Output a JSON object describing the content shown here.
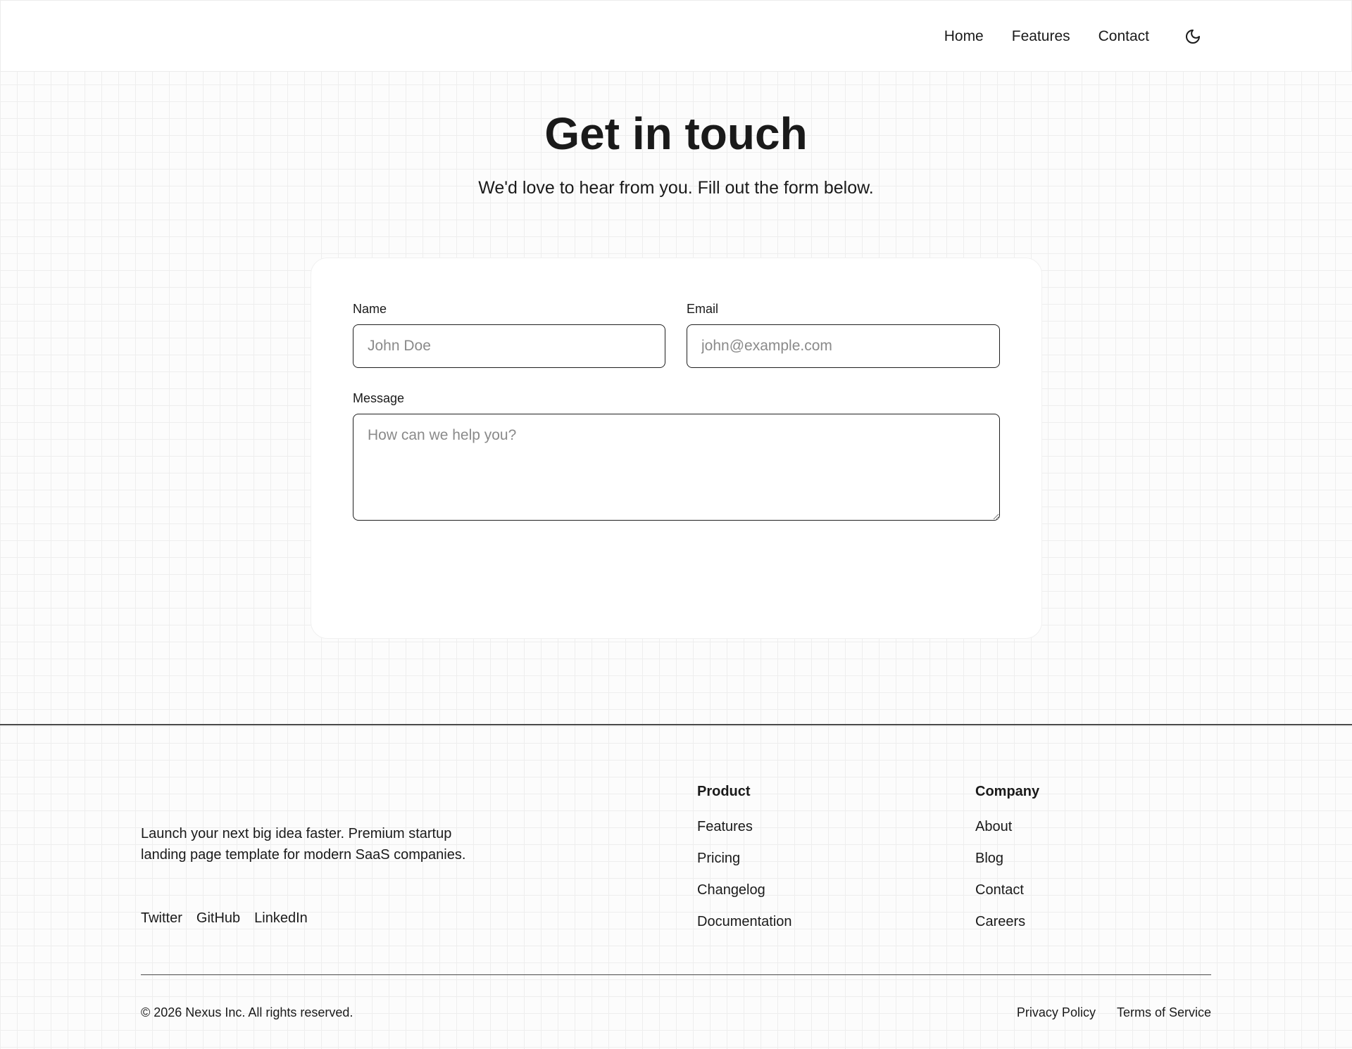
{
  "header": {
    "nav": [
      {
        "label": "Home"
      },
      {
        "label": "Features"
      },
      {
        "label": "Contact"
      }
    ],
    "theme_toggle_icon": "moon-icon"
  },
  "hero": {
    "title": "Get in touch",
    "subtitle": "We'd love to hear from you. Fill out the form below."
  },
  "form": {
    "name": {
      "label": "Name",
      "placeholder": "John Doe",
      "value": ""
    },
    "email": {
      "label": "Email",
      "placeholder": "john@example.com",
      "value": ""
    },
    "message": {
      "label": "Message",
      "placeholder": "How can we help you?",
      "value": ""
    }
  },
  "footer": {
    "tagline": "Launch your next big idea faster. Premium startup landing page template for modern SaaS companies.",
    "social": [
      {
        "label": "Twitter"
      },
      {
        "label": "GitHub"
      },
      {
        "label": "LinkedIn"
      }
    ],
    "columns": [
      {
        "heading": "Product",
        "links": [
          "Features",
          "Pricing",
          "Changelog",
          "Documentation"
        ]
      },
      {
        "heading": "Company",
        "links": [
          "About",
          "Blog",
          "Contact",
          "Careers"
        ]
      }
    ],
    "copyright": "© 2026 Nexus Inc. All rights reserved.",
    "legal": [
      {
        "label": "Privacy Policy"
      },
      {
        "label": "Terms of Service"
      }
    ]
  },
  "colors": {
    "text": "#1a1a1a",
    "background": "#fcfcfc",
    "card": "#ffffff",
    "placeholder": "#8a8a8a"
  }
}
